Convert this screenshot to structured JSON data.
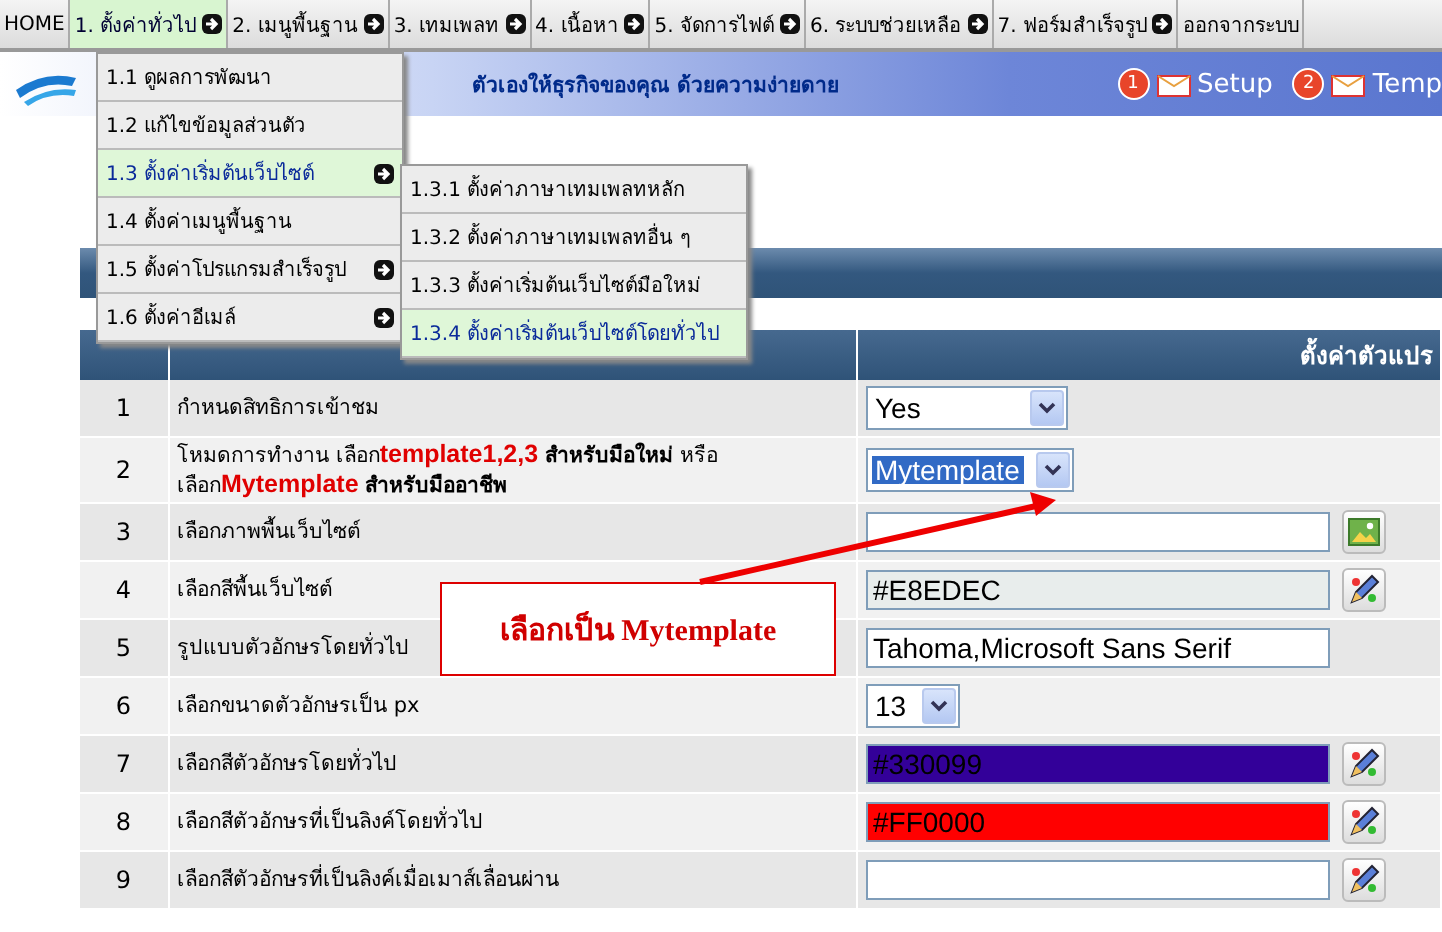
{
  "top_menu": [
    {
      "label": "HOME",
      "selected": false,
      "has_submenu": false
    },
    {
      "label": "1. ตั้งค่าทั่วไป",
      "selected": true,
      "has_submenu": true
    },
    {
      "label": "2. เมนูพื้นฐาน",
      "selected": false,
      "has_submenu": true
    },
    {
      "label": "3. เทมเพลท",
      "selected": false,
      "has_submenu": true
    },
    {
      "label": "4. เนื้อหา",
      "selected": false,
      "has_submenu": true
    },
    {
      "label": "5. จัดการไฟต์",
      "selected": false,
      "has_submenu": true
    },
    {
      "label": "6. ระบบช่วยเหลือ",
      "selected": false,
      "has_submenu": true
    },
    {
      "label": "7. ฟอร์มสำเร็จรูป",
      "selected": false,
      "has_submenu": true
    },
    {
      "label": "ออกจากระบบ",
      "selected": false,
      "has_submenu": false
    }
  ],
  "banner": {
    "slogan": "ตัวเองให้ธุรกิจของคุณ ด้วยความง่ายดาย",
    "steps": [
      {
        "number": "1",
        "label": "Setup"
      },
      {
        "number": "2",
        "label": "Temp"
      }
    ]
  },
  "dropdown": {
    "items": [
      {
        "label": "1.1 ดูผลการพัฒนา",
        "selected": false,
        "has_submenu": false
      },
      {
        "label": "1.2 แก้ไขข้อมูลส่วนตัว",
        "selected": false,
        "has_submenu": false
      },
      {
        "label": "1.3 ตั้งค่าเริ่มต้นเว็บไซต์",
        "selected": true,
        "has_submenu": true
      },
      {
        "label": "1.4 ตั้งค่าเมนูพื้นฐาน",
        "selected": false,
        "has_submenu": false
      },
      {
        "label": "1.5 ตั้งค่าโปรแกรมสำเร็จรูป",
        "selected": false,
        "has_submenu": true
      },
      {
        "label": "1.6 ตั้งค่าอีเมล์",
        "selected": false,
        "has_submenu": true
      }
    ]
  },
  "submenu": {
    "items": [
      {
        "label": "1.3.1 ตั้งค่าภาษาเทมเพลทหลัก",
        "selected": false
      },
      {
        "label": "1.3.2 ตั้งค่าภาษาเทมเพลทอื่น ๆ",
        "selected": false
      },
      {
        "label": "1.3.3 ตั้งค่าเริ่มต้นเว็บไซต์มือใหม่",
        "selected": false
      },
      {
        "label": "1.3.4 ตั้งค่าเริ่มต้นเว็บไซต์โดยทั่วไป",
        "selected": true
      }
    ]
  },
  "table": {
    "column_3": "ตั้งค่าตัวแปร",
    "rows": [
      {
        "number": "1",
        "description": "กำหนดสิทธิการเข้าชม",
        "kind": "select",
        "value": "Yes",
        "focused": false
      },
      {
        "number": "2",
        "description_parts": [
          {
            "kind": "plain",
            "text": "โหมดการทำงาน เลือก"
          },
          {
            "kind": "highlight",
            "text": "template1,2,3"
          },
          {
            "kind": "strong",
            "text": "สำหรับมือใหม่"
          },
          {
            "kind": "plain",
            "text": "หรือเลือก"
          },
          {
            "kind": "highlight",
            "text": "Mytemplate"
          },
          {
            "kind": "strong",
            "text": "สำหรับมืออาชีพ"
          }
        ],
        "kind": "select",
        "value": "Mytemplate",
        "focused": true
      },
      {
        "number": "3",
        "description": "เลือกภาพพื้นเว็บไซต์",
        "kind": "image"
      },
      {
        "number": "4",
        "description": "เลือกสีพื้นเว็บไซต์",
        "kind": "color",
        "value": "#E8EDEC"
      },
      {
        "number": "5",
        "description": "รูปแบบตัวอักษรโดยทั่วไป",
        "kind": "text",
        "value": "Tahoma,Microsoft Sans Serif"
      },
      {
        "number": "6",
        "description": "เลือกขนาดตัวอักษรเป็น px",
        "kind": "select",
        "value": "13",
        "focused": false
      },
      {
        "number": "7",
        "description": "เลือกสีตัวอักษรโดยทั่วไป",
        "kind": "color",
        "value": "#330099"
      },
      {
        "number": "8",
        "description": "เลือกสีตัวอักษรที่เป็นลิงค์โดยทั่วไป",
        "kind": "color",
        "value": "#FF0000"
      },
      {
        "number": "9",
        "description": "เลือกสีตัวอักษรที่เป็นลิงค์เมื่อเมาส์เลื่อนผ่าน",
        "kind": "color"
      }
    ]
  },
  "annotation": {
    "text": "เลือกเป็น Mytemplate"
  }
}
